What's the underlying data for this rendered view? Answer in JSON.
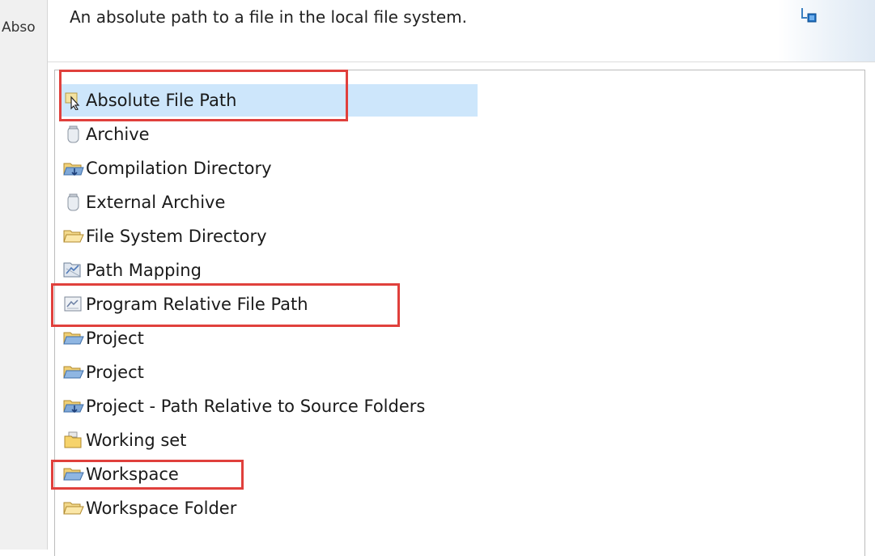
{
  "parent": {
    "cut_label": "Abso"
  },
  "header": {
    "description": "An absolute path to a file in the local file system."
  },
  "items": [
    {
      "label": "Absolute File Path",
      "icon": "cursor-file-icon",
      "selected": true
    },
    {
      "label": "Archive",
      "icon": "jar-icon"
    },
    {
      "label": "Compilation Directory",
      "icon": "folder-compile-icon"
    },
    {
      "label": "External Archive",
      "icon": "jar-icon"
    },
    {
      "label": "File System Directory",
      "icon": "folder-open-icon"
    },
    {
      "label": "Path Mapping",
      "icon": "mapping-icon"
    },
    {
      "label": "Program Relative File Path",
      "icon": "program-relative-icon"
    },
    {
      "label": "Project",
      "icon": "folder-project-icon"
    },
    {
      "label": "Project",
      "icon": "folder-project-icon"
    },
    {
      "label": "Project - Path Relative to Source Folders",
      "icon": "folder-source-icon"
    },
    {
      "label": "Working set",
      "icon": "working-set-icon"
    },
    {
      "label": "Workspace",
      "icon": "folder-workspace-icon"
    },
    {
      "label": "Workspace Folder",
      "icon": "folder-open-icon"
    }
  ],
  "colors": {
    "highlight": "#e0403c",
    "selection": "#cde6fb"
  }
}
